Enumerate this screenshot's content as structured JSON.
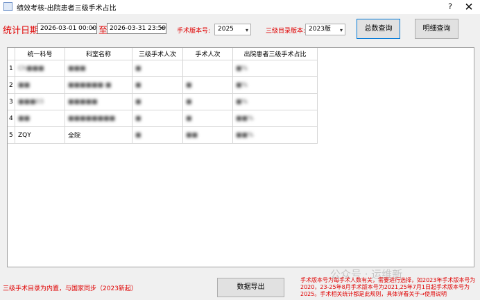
{
  "window": {
    "title": "绩效考核-出院患者三级手术占比",
    "help": "?",
    "close": "✕"
  },
  "toolbar": {
    "date_label": "统计日期:",
    "start_date": "2026-03-01 00:00",
    "to_label": "至",
    "end_date": "2026-03-31 23:59",
    "surgery_version_label": "手术版本号:",
    "surgery_version_value": "2025",
    "catalog_version_label": "三级目录版本:",
    "catalog_version_value": "2023版",
    "total_query_button": "总数查询",
    "detail_query_button": "明细查询"
  },
  "grid": {
    "columns": [
      "统一科号",
      "科室名称",
      "三级手术人次",
      "手术人次",
      "出院患者三级手术占比"
    ],
    "rows": [
      {
        "num": "1",
        "cells": [
          "Ch■■■",
          "■■■",
          "■",
          "",
          "■%"
        ],
        "redacted": true
      },
      {
        "num": "2",
        "cells": [
          "■■",
          "■■■■■■ ■",
          "■",
          "■",
          "■%"
        ],
        "redacted": true
      },
      {
        "num": "3",
        "cells": [
          "■■■03",
          "■■■■■",
          "■",
          "■",
          "■%"
        ],
        "redacted": true
      },
      {
        "num": "4",
        "cells": [
          "■■",
          "■■■■■■■■",
          "■",
          "■",
          "■■%"
        ],
        "redacted": true
      },
      {
        "num": "5",
        "cells": [
          "ZQY",
          "全院",
          "■",
          "■■",
          "■■%"
        ],
        "redacted": false
      }
    ]
  },
  "footer": {
    "left_note": "三级手术目录为内置，与国家同步（2023新起）",
    "export_button": "数据导出",
    "right_note": "手术版本号为每手术人数有关，需要进行选择，如2023年手术版本号为2020，23-25年8月手术版本号为2021,25年7月1日起手术版本号为2025。手术相关统计都是此规则，具体详看关于→使用说明",
    "watermark": "公众号 · 运维新"
  },
  "colors": {
    "accent_red": "#e00000",
    "focus_blue": "#0078d7",
    "window_bg": "#f0f0f0"
  }
}
